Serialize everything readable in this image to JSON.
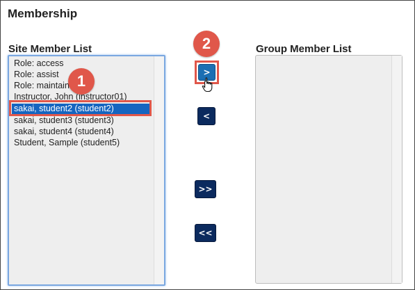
{
  "title": "Membership",
  "site_list": {
    "heading": "Site Member List",
    "options": [
      "Role: access",
      "Role: assist",
      "Role: maintain",
      "Instructor, John (instructor01)",
      "sakai, student2 (student2)",
      "sakai, student3 (student3)",
      "sakai, student4 (student4)",
      "Student, Sample (student5)"
    ],
    "selected_index": 4
  },
  "group_list": {
    "heading": "Group Member List",
    "options": []
  },
  "buttons": {
    "add": ">",
    "remove": "<",
    "add_all": ">>",
    "remove_all": "<<"
  },
  "callouts": {
    "one": "1",
    "two": "2"
  },
  "colors": {
    "selection": "#1565c0",
    "button": "#0b2a5e",
    "callout": "#e0574a"
  },
  "icons": {
    "pointer": "hand-pointer-icon"
  }
}
